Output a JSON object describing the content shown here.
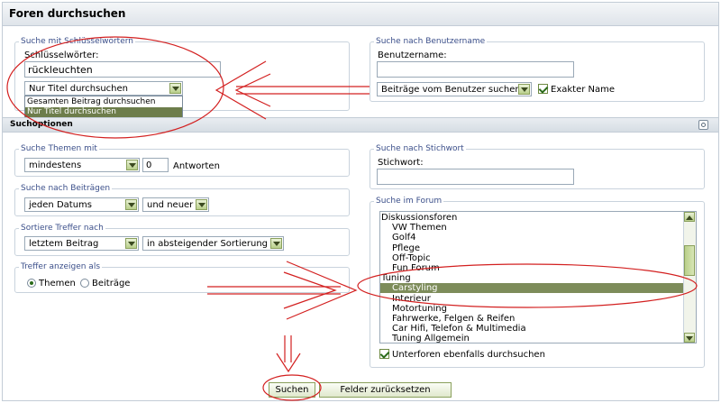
{
  "page_title": "Foren durchsuchen",
  "keyword_search": {
    "legend": "Suche mit Schlüsselwörtern",
    "label": "Schlüsselwörter:",
    "value": "rückleuchten",
    "scope_selected": "Nur Titel durchsuchen",
    "scope_options": [
      "Gesamten Beitrag durchsuchen",
      "Nur Titel durchsuchen"
    ]
  },
  "user_search": {
    "legend": "Suche nach Benutzername",
    "label": "Benutzername:",
    "value": "",
    "mode_selected": "Beiträge vom Benutzer suchen",
    "exact_label": "Exakter Name",
    "exact_checked": true
  },
  "section_title": "Suchoptionen",
  "threads_with": {
    "legend": "Suche Themen mit",
    "qualifier": "mindestens",
    "count": "0",
    "suffix": "Antworten"
  },
  "posts_by_date": {
    "legend": "Suche nach Beiträgen",
    "date": "jeden Datums",
    "direction": "und neuer"
  },
  "sort": {
    "legend": "Sortiere Treffer nach",
    "field": "letztem Beitrag",
    "order": "in absteigender Sortierung"
  },
  "display_as": {
    "legend": "Treffer anzeigen als",
    "options": [
      "Themen",
      "Beiträge"
    ],
    "selected": "Themen"
  },
  "tag_search": {
    "legend": "Suche nach Stichwort",
    "label": "Stichwort:",
    "value": ""
  },
  "forum_search": {
    "legend": "Suche im Forum",
    "items": [
      {
        "label": "Diskussionsforen",
        "indent": 0,
        "selected": false
      },
      {
        "label": "VW Themen",
        "indent": 1,
        "selected": false
      },
      {
        "label": "Golf4",
        "indent": 1,
        "selected": false
      },
      {
        "label": "Pflege",
        "indent": 1,
        "selected": false
      },
      {
        "label": "Off-Topic",
        "indent": 1,
        "selected": false
      },
      {
        "label": "Fun Forum",
        "indent": 1,
        "selected": false
      },
      {
        "label": "Tuning",
        "indent": 0,
        "selected": false
      },
      {
        "label": "Carstyling",
        "indent": 1,
        "selected": true
      },
      {
        "label": "Interieur",
        "indent": 1,
        "selected": false
      },
      {
        "label": "Motortuning",
        "indent": 1,
        "selected": false
      },
      {
        "label": "Fahrwerke, Felgen & Reifen",
        "indent": 1,
        "selected": false
      },
      {
        "label": "Car Hifi, Telefon & Multimedia",
        "indent": 1,
        "selected": false
      },
      {
        "label": "Tuning Allgemein",
        "indent": 1,
        "selected": false
      }
    ],
    "subforums_label": "Unterforen ebenfalls durchsuchen",
    "subforums_checked": true
  },
  "actions": {
    "search_label": "Suchen",
    "reset_label": "Felder zurücksetzen"
  },
  "colors": {
    "annotation": "#d32020",
    "legend_text": "#3b4f8a",
    "selection": "#7d8c5a"
  }
}
